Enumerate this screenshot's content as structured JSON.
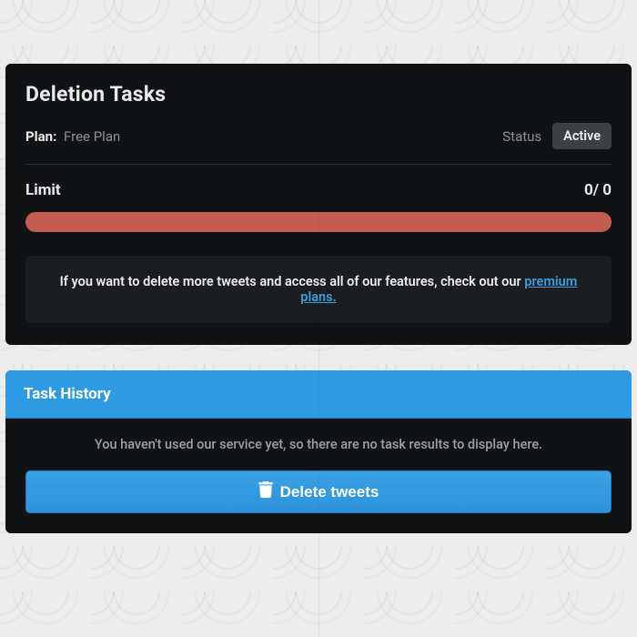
{
  "deletion_tasks": {
    "title": "Deletion Tasks",
    "plan_label": "Plan:",
    "plan_value": "Free Plan",
    "status_label": "Status",
    "status_badge": "Active",
    "limit_label": "Limit",
    "limit_used": 0,
    "limit_total": 0,
    "limit_display": "0/ 0",
    "progress_percent": 100,
    "callout_prefix": "If you want to delete more tweets and access all of our features, check out our ",
    "callout_link_text": "premium plans."
  },
  "task_history": {
    "title": "Task History",
    "empty_message": "You haven't used our service yet, so there are no task results to display here.",
    "delete_button_label": "Delete tweets"
  },
  "colors": {
    "card_bg": "#111214",
    "accent_blue": "#2d9ae2",
    "progress_red": "#c45d4f",
    "badge_bg": "#3c3f44"
  }
}
